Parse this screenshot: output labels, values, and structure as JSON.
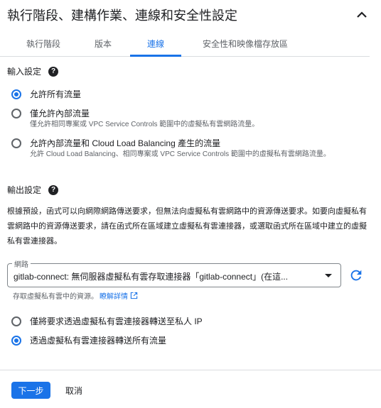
{
  "header": {
    "title": "執行階段、建構作業、連線和安全性設定"
  },
  "tabs": [
    {
      "label": "執行階段"
    },
    {
      "label": "版本"
    },
    {
      "label": "連線"
    },
    {
      "label": "安全性和映像檔存放區"
    }
  ],
  "ingress": {
    "title": "輸入設定",
    "options": [
      {
        "label": "允許所有流量",
        "desc": ""
      },
      {
        "label": "僅允許內部流量",
        "desc": "僅允許相同專案或 VPC Service Controls 範圍中的虛擬私有雲網路流量。"
      },
      {
        "label": "允許內部流量和 Cloud Load Balancing 產生的流量",
        "desc": "允許 Cloud Load Balancing、相同專案或 VPC Service Controls 範圍中的虛擬私有雲網路流量。"
      }
    ]
  },
  "egress": {
    "title": "輸出設定",
    "description": "根據預設，函式可以向網際網路傳送要求，但無法向虛擬私有雲網路中的資源傳送要求。如要向虛擬私有雲網路中的資源傳送要求，請在函式所在區域建立虛擬私有雲連接器，或選取函式所在區域中建立的虛擬私有雲連接器。",
    "network_label": "網路",
    "network_value": "gitlab-connect: 無伺服器虛擬私有雲存取連接器「gitlab-connect」(在這...",
    "hint": "存取虛擬私有雲中的資源。",
    "learn_more": "瞭解詳情",
    "options": [
      {
        "label": "僅將要求透過虛擬私有雲連接器轉送至私人 IP"
      },
      {
        "label": "透過虛擬私有雲連接器轉送所有流量"
      }
    ]
  },
  "footer": {
    "next_label": "下一步",
    "cancel_label": "取消"
  },
  "colors": {
    "accent": "#1a73e8",
    "text": "#202124",
    "muted": "#5f6368",
    "divider": "#dadce0"
  }
}
